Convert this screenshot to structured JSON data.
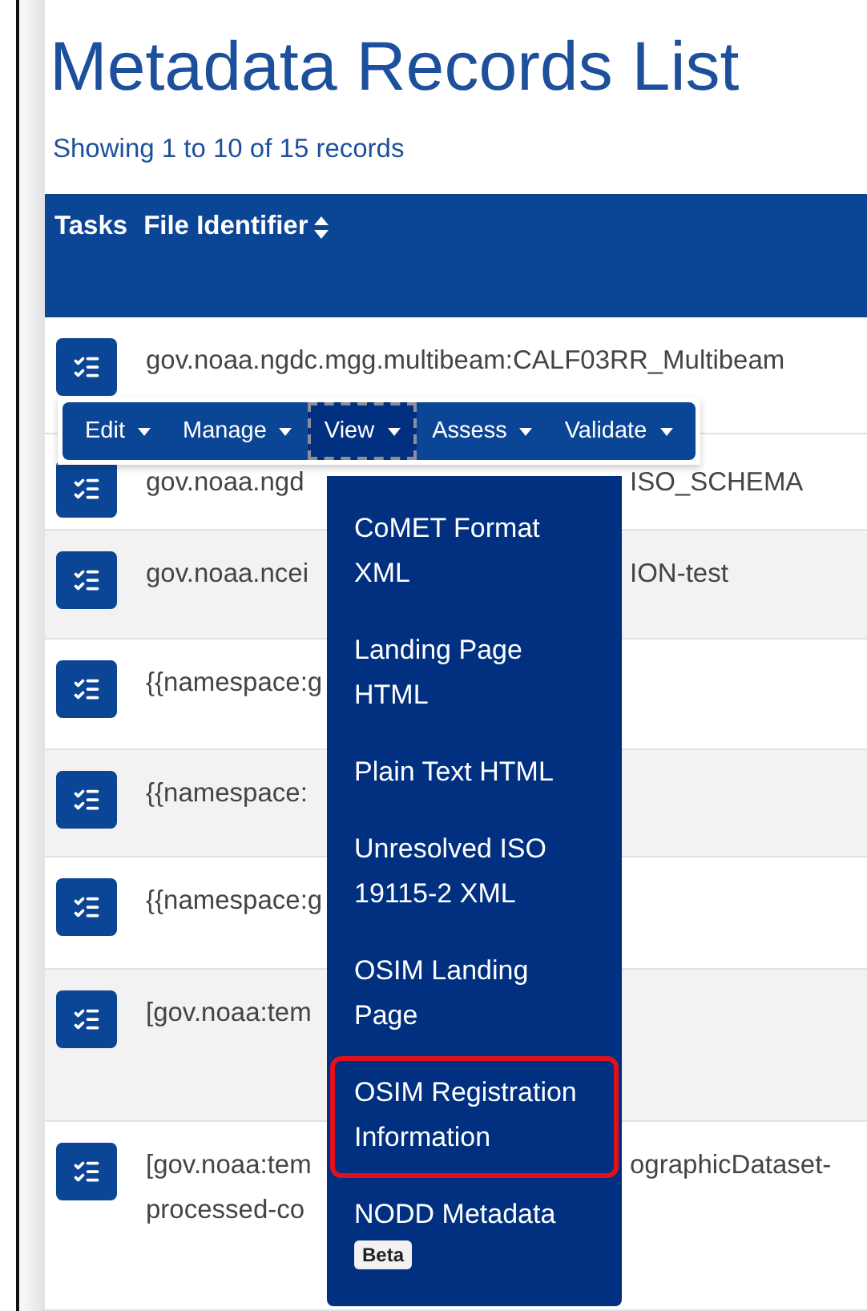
{
  "title": "Metadata Records List",
  "summary": "Showing 1 to 10 of 15 records",
  "table": {
    "columns": [
      {
        "label": "Tasks",
        "sortable": false
      },
      {
        "label": "File Identifier",
        "sortable": true
      }
    ],
    "rows": [
      {
        "lines": [
          {
            "left": "gov.noaa.ngdc.mgg.multibeam:CALF03RR_Multibeam"
          }
        ]
      },
      {
        "lines": [
          {
            "left": "gov.noaa.ngd",
            "right": "ISO_SCHEMA"
          }
        ]
      },
      {
        "lines": [
          {
            "left": "gov.noaa.ncei",
            "right": "ION-test"
          }
        ]
      },
      {
        "lines": [
          {
            "left": "{{namespace:g"
          }
        ]
      },
      {
        "lines": [
          {
            "left": "{{namespace:"
          }
        ]
      },
      {
        "lines": [
          {
            "left": "{{namespace:g"
          }
        ]
      },
      {
        "lines": [
          {
            "left": "[gov.noaa:tem"
          }
        ]
      },
      {
        "lines": [
          {
            "left": "[gov.noaa:tem",
            "right": "ographicDataset-"
          },
          {
            "left": "processed-co"
          }
        ]
      }
    ]
  },
  "task_toolbar": [
    {
      "label": "Edit",
      "selected": false
    },
    {
      "label": "Manage",
      "selected": false
    },
    {
      "label": "View",
      "selected": true
    },
    {
      "label": "Assess",
      "selected": false
    },
    {
      "label": "Validate",
      "selected": false
    }
  ],
  "view_menu": [
    {
      "label": "CoMET Format XML",
      "highlighted": false
    },
    {
      "label": "Landing Page HTML",
      "highlighted": false
    },
    {
      "label": "Plain Text HTML",
      "highlighted": false
    },
    {
      "label": "Unresolved ISO 19115-2 XML",
      "highlighted": false
    },
    {
      "label": "OSIM Landing Page",
      "highlighted": false
    },
    {
      "label": "OSIM Registration Information",
      "highlighted": true
    },
    {
      "label": "NODD Metadata",
      "highlighted": false,
      "badge": "Beta"
    }
  ]
}
